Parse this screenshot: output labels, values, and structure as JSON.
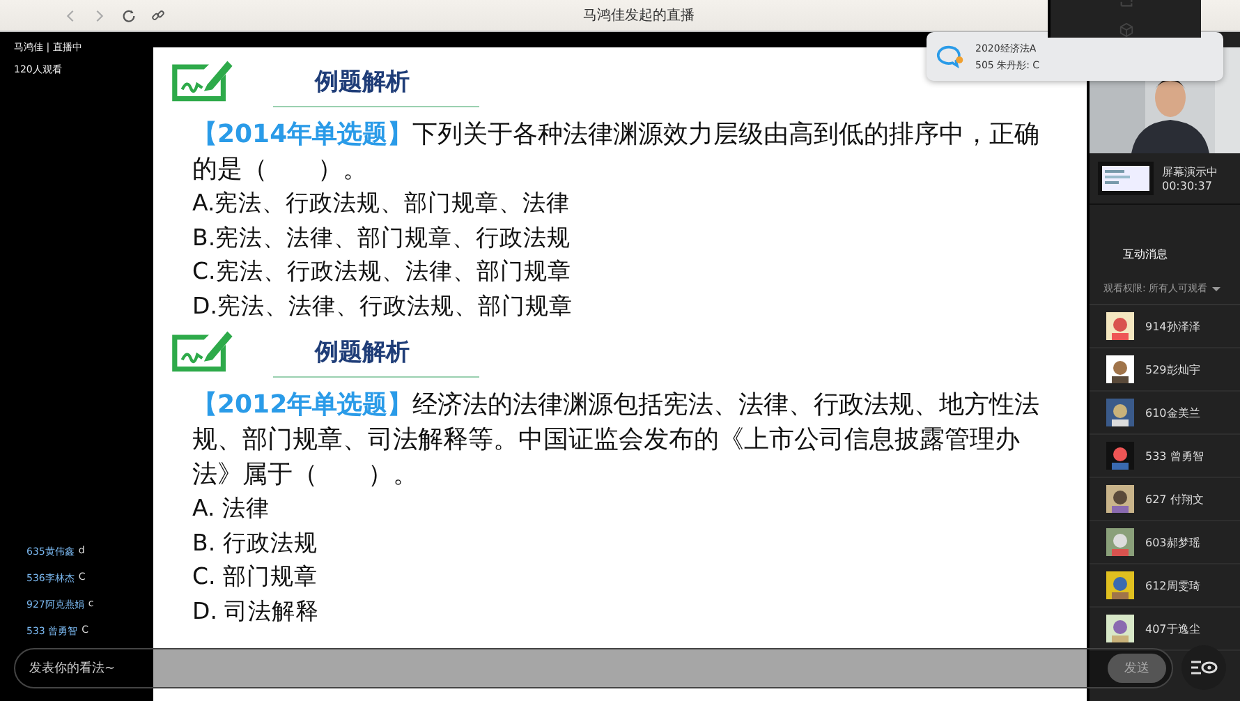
{
  "window": {
    "title": "马鸿佳发起的直播"
  },
  "live": {
    "host": "马鸿佳 | 直播中",
    "viewers": "120人观看"
  },
  "notification": {
    "title": "2020经济法A",
    "message": "505 朱丹彤: C"
  },
  "slide": {
    "sections": [
      {
        "heading": "例题解析",
        "tag": "【2014年单选题】",
        "question": "下列关于各种法律渊源效力层级由高到低的排序中，正确的是（　　）。",
        "options": [
          "A.宪法、行政法规、部门规章、法律",
          "B.宪法、法律、部门规章、行政法规",
          "C.宪法、行政法规、法律、部门规章",
          "D.宪法、法律、行政法规、部门规章"
        ]
      },
      {
        "heading": "例题解析",
        "tag": "【2012年单选题】",
        "question": "经济法的法律渊源包括宪法、法律、行政法规、地方性法规、部门规章、司法解释等。中国证监会发布的《上市公司信息披露管理办法》属于（　　）。",
        "options": [
          "A. 法律",
          "B. 行政法规",
          "C. 部门规章",
          "D. 司法解释"
        ]
      }
    ]
  },
  "screen_share": {
    "label": "屏幕演示中",
    "time": "00:30:37"
  },
  "tabs": [
    {
      "label": "互动消息",
      "selected": true
    }
  ],
  "permission": "观看权限: 所有人可观看",
  "members": [
    {
      "name": "914孙泽泽"
    },
    {
      "name": "529彭灿宇"
    },
    {
      "name": "610金美兰"
    },
    {
      "name": "533 曾勇智"
    },
    {
      "name": "627 付翔文"
    },
    {
      "name": "603郝梦瑶"
    },
    {
      "name": "612周雯琦"
    },
    {
      "name": "407于逸尘"
    }
  ],
  "chat": [
    {
      "name": "635黄伟鑫",
      "text": "d"
    },
    {
      "name": "536李林杰",
      "text": "C"
    },
    {
      "name": "927阿克燕娟",
      "text": "c"
    },
    {
      "name": "533 曾勇智",
      "text": "C"
    }
  ],
  "comment": {
    "placeholder": "发表你的看法~",
    "send": "发送"
  }
}
